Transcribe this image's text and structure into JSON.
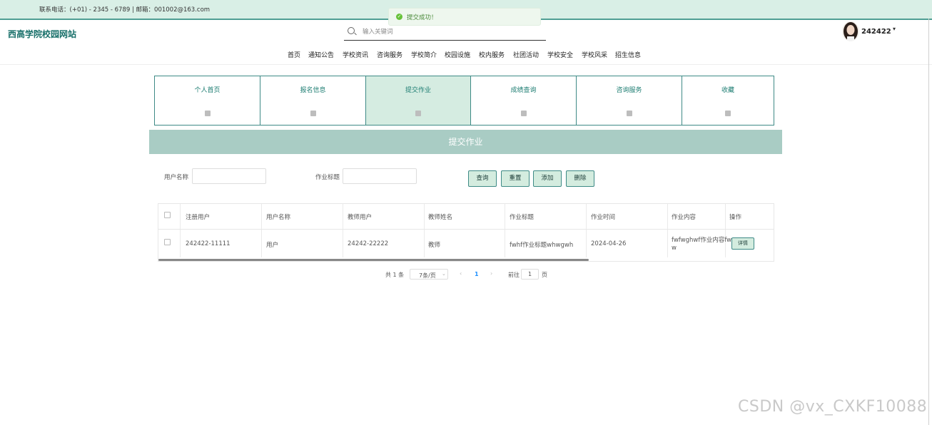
{
  "topbar": {
    "contact": "联系电话：(+01) - 2345 - 6789 | 邮箱：001002@163.com"
  },
  "toast": {
    "message": "提交成功！",
    "icon": "success-check-icon",
    "color": "#67c23a"
  },
  "header": {
    "site_title": "西高学院校园网站",
    "search_placeholder": "输入关键词",
    "username": "242422",
    "user_menu_caret": "▾"
  },
  "nav": {
    "items": [
      "首页",
      "通知公告",
      "学校资讯",
      "咨询服务",
      "学校简介",
      "校园设施",
      "校内服务",
      "社团活动",
      "学校安全",
      "学校风采",
      "招生信息"
    ]
  },
  "cards": [
    {
      "label": "个人首页",
      "active": false
    },
    {
      "label": "报名信息",
      "active": false
    },
    {
      "label": "提交作业",
      "active": true
    },
    {
      "label": "成绩查询",
      "active": false
    },
    {
      "label": "咨询服务",
      "active": false
    },
    {
      "label": "收藏",
      "active": false
    }
  ],
  "section": {
    "title": "提交作业"
  },
  "filters": {
    "user_name_label": "用户名称",
    "user_name_value": "",
    "homework_title_label": "作业标题",
    "homework_title_value": ""
  },
  "actions": {
    "query": "查询",
    "reset": "重置",
    "add": "添加",
    "delete": "删除"
  },
  "table": {
    "headers": [
      "注册用户",
      "用户名称",
      "教师用户",
      "教师姓名",
      "作业标题",
      "作业时间",
      "作业内容",
      "操作"
    ],
    "rows": [
      {
        "reg_user": "242422-11111",
        "user_name": "用户",
        "teacher_user": "24242-22222",
        "teacher_name": "教师",
        "hw_title": "fwhf作业标题whwgwh",
        "hw_time": "2024-04-26",
        "hw_content_line1": "fwfwghwf作业内容fw",
        "hw_content_line2": "w",
        "action": "详情"
      }
    ]
  },
  "pagination": {
    "total": "共 1 条",
    "page_size": "7条/页",
    "prev": "‹",
    "current": "1",
    "next": "›",
    "goto_label": "前往",
    "goto_value": "1",
    "page_suffix": "页"
  },
  "watermark": "CSDN @vx_CXKF10088",
  "colors": {
    "accent": "#3e8a86",
    "banner": "#a9ccc4",
    "topbar": "#d9efe6"
  }
}
